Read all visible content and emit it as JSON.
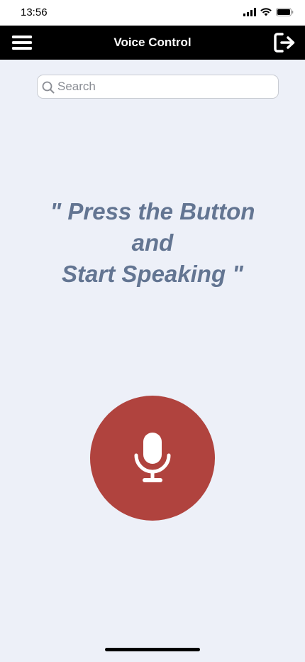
{
  "status_bar": {
    "time": "13:56",
    "icons": [
      "cellular-signal-icon",
      "wifi-icon",
      "battery-icon"
    ]
  },
  "nav": {
    "title": "Voice Control",
    "left_icon": "hamburger-menu-icon",
    "right_icon": "logout-icon"
  },
  "search": {
    "placeholder": "Search",
    "value": ""
  },
  "prompt": {
    "line1": "\" Press the Button",
    "line2": "and",
    "line3": "Start Speaking \""
  },
  "mic": {
    "icon": "microphone-icon"
  },
  "colors": {
    "background": "#edf0f8",
    "nav_background": "#000000",
    "prompt_text": "#637592",
    "mic_button": "#b0433e"
  }
}
